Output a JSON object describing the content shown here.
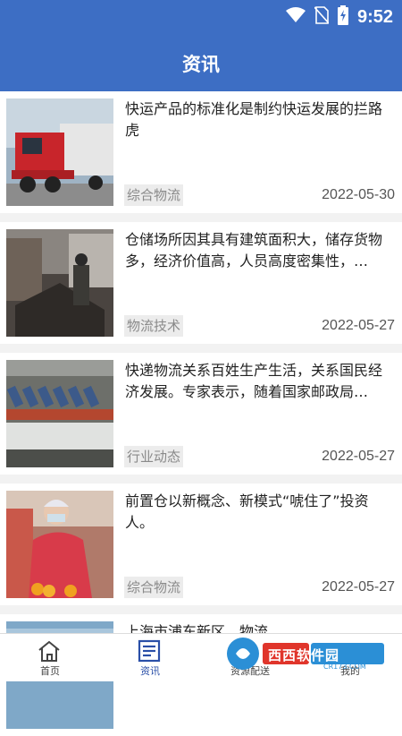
{
  "status_bar": {
    "time": "9:52"
  },
  "header": {
    "title": "资讯"
  },
  "articles": [
    {
      "title": "快运产品的标准化是制约快运发展的拦路虎",
      "tag": "综合物流",
      "date": "2022-05-30"
    },
    {
      "title": "仓储场所因其具有建筑面积大，储存货物多，经济价值高，人员高度密集性，…",
      "tag": "物流技术",
      "date": "2022-05-27"
    },
    {
      "title": "快递物流关系百姓生产生活，关系国民经济发展。专家表示，随着国家邮政局…",
      "tag": "行业动态",
      "date": "2022-05-27"
    },
    {
      "title": "前置仓以新概念、新模式“唬住了”投资人。",
      "tag": "综合物流",
      "date": "2022-05-27"
    },
    {
      "title": "上海市浦东新区…物流…",
      "tag": "",
      "date": ""
    }
  ],
  "tabbar": {
    "items": [
      {
        "label": "首页",
        "icon": "home-icon"
      },
      {
        "label": "资讯",
        "icon": "news-icon"
      },
      {
        "label": "资源配送",
        "icon": "delivery-icon"
      },
      {
        "label": "我的",
        "icon": "profile-icon"
      }
    ]
  },
  "watermark": {
    "text": "西西软件园",
    "url_text": "CR173.COM"
  },
  "colors": {
    "header": "#3d6ec4",
    "active_tab": "#2a4fa8"
  }
}
